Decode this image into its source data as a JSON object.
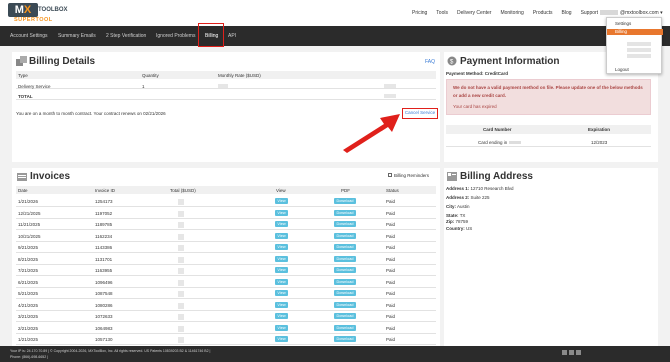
{
  "header": {
    "logo_text": "MX TOOLBOX",
    "logo_sub": "SUPERTOOL",
    "nav": [
      "Pricing",
      "Tools",
      "Delivery Center",
      "Monitoring",
      "Products",
      "Blog",
      "Support"
    ],
    "account_suffix": "@mxtoolbox.com"
  },
  "account_menu": {
    "items": [
      "Settings",
      "Billing",
      "Logout"
    ]
  },
  "subnav": {
    "tabs": [
      "Account Settings",
      "Summary Emails",
      "2 Step Verification",
      "Ignored Problems",
      "Billing",
      "API"
    ]
  },
  "billing_details": {
    "title": "Billing Details",
    "faq": "FAQ",
    "headers": [
      "Type",
      "Quantity",
      "Monthly Rate ($USD)"
    ],
    "row": {
      "type": "Delivery Service",
      "quantity": "1"
    },
    "total_label": "TOTAL",
    "contract_text": "You are on a month to month contract. Your contract renews on 02/21/2026",
    "cancel_label": "Cancel Service"
  },
  "payment": {
    "title": "Payment Information",
    "method": "Payment Method: CreditCard",
    "alert_text": "We do not have a valid payment method on file. Please update one of the below methods or add a new credit card.",
    "alert_expired": "Your card has expired",
    "card_headers": [
      "Card Number",
      "Expiration"
    ],
    "card_number": "Card ending in",
    "card_exp": "12/2023"
  },
  "invoices": {
    "title": "Invoices",
    "reminders_label": "Billing Reminders",
    "headers": [
      "Date",
      "Invoice ID",
      "Total ($USD)",
      "View",
      "PDF",
      "Status"
    ],
    "view_label": "View",
    "download_label": "Download",
    "rows": [
      {
        "date": "1/21/2026",
        "id": "1254173",
        "status": "Paid"
      },
      {
        "date": "12/21/2025",
        "id": "1197052",
        "status": "Paid"
      },
      {
        "date": "11/21/2025",
        "id": "1189785",
        "status": "Paid"
      },
      {
        "date": "10/21/2025",
        "id": "1162234",
        "status": "Paid"
      },
      {
        "date": "9/21/2025",
        "id": "1143386",
        "status": "Paid"
      },
      {
        "date": "8/21/2025",
        "id": "1131701",
        "status": "Paid"
      },
      {
        "date": "7/21/2025",
        "id": "1163955",
        "status": "Paid"
      },
      {
        "date": "6/21/2025",
        "id": "1096496",
        "status": "Paid"
      },
      {
        "date": "5/21/2025",
        "id": "1087548",
        "status": "Paid"
      },
      {
        "date": "4/21/2025",
        "id": "1080286",
        "status": "Paid"
      },
      {
        "date": "3/21/2025",
        "id": "1072633",
        "status": "Paid"
      },
      {
        "date": "2/21/2025",
        "id": "1064983",
        "status": "Paid"
      },
      {
        "date": "1/21/2025",
        "id": "1057130",
        "status": "Paid"
      }
    ]
  },
  "billing_address": {
    "title": "Billing Address",
    "lines": [
      {
        "label": "Address 1:",
        "value": "12710 Research Blvd"
      },
      {
        "label": "Address 2:",
        "value": "Suite 225"
      },
      {
        "label": "City:",
        "value": "Austin"
      },
      {
        "label": "State:",
        "value": "TX"
      },
      {
        "label": "Zip:",
        "value": "78759"
      },
      {
        "label": "Country:",
        "value": "US"
      }
    ]
  },
  "footer": {
    "line1": "Your IP is: 24.170.70.89 | © Copyright 2004-2026, MXToolBox, Inc. All rights reserved. US Patents 10839203 B2 & 11461746 B2 |",
    "line2": "Phone: (866)-698-6652 |"
  },
  "colors": {
    "accent": "#e8772e",
    "highlight": "#e0201b",
    "button": "#5bc0de",
    "subnav_bg": "#2b2b2b"
  }
}
